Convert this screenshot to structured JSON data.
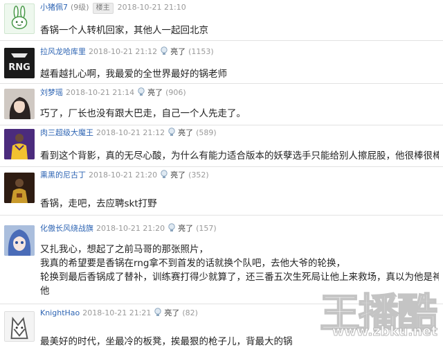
{
  "posts": [
    {
      "user": "小猪佩7",
      "level": "(9级)",
      "badge": "楼主",
      "time": "2018-10-21 21:10",
      "lines": [
        "香锅一个人转机回家，其他人一起回北京"
      ]
    },
    {
      "user": "拉风龙哈库里",
      "time": "2018-10-21 21:12",
      "like_label": "亮了",
      "like_count": "(1153)",
      "lines": [
        "越看越扎心啊，我最爱的全世界最好的锅老师"
      ]
    },
    {
      "user": "刘梦瑶",
      "time": "2018-10-21 21:14",
      "like_label": "亮了",
      "like_count": "(906)",
      "lines": [
        "巧了，厂长也没有跟大巴走，自己一个人先走了。"
      ]
    },
    {
      "user": "肉三超级大魔王",
      "time": "2018-10-21 21:12",
      "like_label": "亮了",
      "like_count": "(589)",
      "lines": [
        "看到这个背影，真的无尽心酸，为什么有能力适合版本的妖孽选手只能给别人擦屁股，他很棒很棒"
      ]
    },
    {
      "user": "熏黑的尼古丁",
      "time": "2018-10-21 21:20",
      "like_label": "亮了",
      "like_count": "(352)",
      "lines": [
        "香锅，走吧，去应聘skt打野"
      ]
    },
    {
      "user": "化傲长风绕战旗",
      "time": "2018-10-21 21:20",
      "like_label": "亮了",
      "like_count": "(157)",
      "lines": [
        "又扎我心，想起了之前马哥的那张照片，",
        "我真的希望要是香锅在rng拿不到首发的话就换个队吧，去他大爷的轮换，",
        "轮换到最后香锅成了替补，训练赛打得少就算了，还三番五次生死局让他上来救场，真以为他是神仙，我",
        "他"
      ]
    },
    {
      "user": "KnightHao",
      "time": "2018-10-21 21:21",
      "like_label": "亮了",
      "like_count": "(82)",
      "lines": [
        "最美好的时代，坐最冷的板凳，挨最狠的枪子儿，背最大的锅"
      ]
    }
  ],
  "avatars": [
    {
      "name": "rabbit-avatar",
      "text": ""
    },
    {
      "name": "rng-logo-avatar",
      "text": "RNG"
    },
    {
      "name": "girl-photo-avatar",
      "text": ""
    },
    {
      "name": "purple-jersey-avatar",
      "text": ""
    },
    {
      "name": "dark-photo-avatar",
      "text": ""
    },
    {
      "name": "anime-girl-avatar",
      "text": ""
    },
    {
      "name": "wolf-avatar",
      "text": ""
    }
  ],
  "watermark": {
    "brand": "王播酷",
    "url": "www.zbku.net"
  },
  "colors": {
    "username": "#2d64b3",
    "separator": "#e2e2e2",
    "meta": "#999999"
  }
}
